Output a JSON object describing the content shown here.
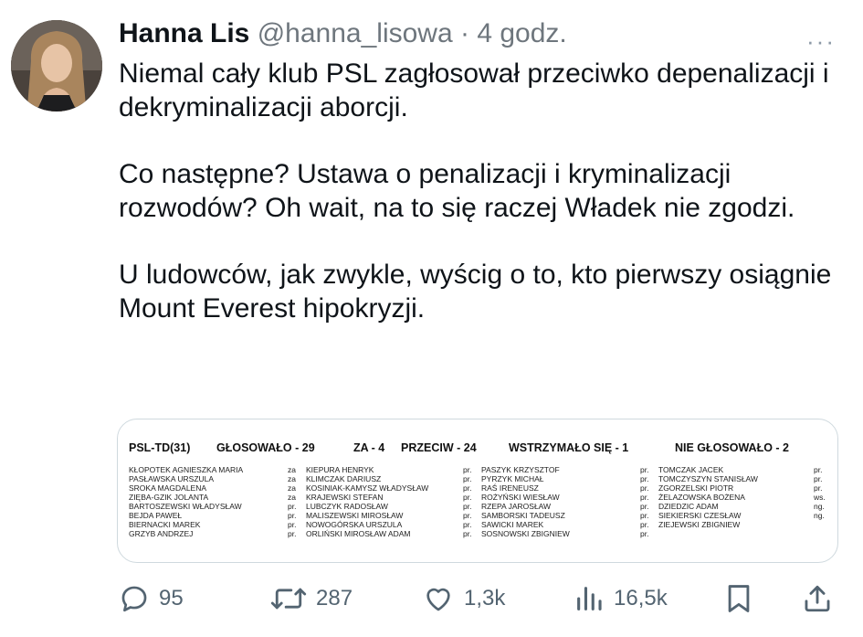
{
  "tweet": {
    "author_name": "Hanna Lis",
    "handle": "@hanna_lisowa",
    "separator": "·",
    "time": "4 godz.",
    "more": "···",
    "paragraphs": [
      "Niemal cały klub PSL zagłosował przeciwko depenalizacji i dekryminalizacji aborcji.",
      "Co następne? Ustawa o penalizacji i kryminalizacji rozwodów? Oh wait, na to się raczej Władek nie zgodzi.",
      "U ludowców, jak zwykle, wyścig o to, kto pierwszy osiągnie Mount Everest hipokryzji."
    ]
  },
  "vote_image": {
    "headers": {
      "club": "PSL-TD(31)",
      "voted": "GŁOSOWAŁO - 29",
      "for": "ZA - 4",
      "against": "PRZECIW - 24",
      "abstained": "WSTRZYMAŁO SIĘ - 1",
      "not_voted": "NIE GŁOSOWAŁO - 2"
    },
    "col1_names": [
      "KŁOPOTEK AGNIESZKA MARIA",
      "PASŁAWSKA URSZULA",
      "SROKA MAGDALENA",
      "ZIĘBA-GZIK JOLANTA",
      "BARTOSZEWSKI WŁADYSŁAW",
      "BEJDA PAWEŁ",
      "BIERNACKI MAREK",
      "GRZYB ANDRZEJ"
    ],
    "col1_votes": [
      "za",
      "za",
      "za",
      "za",
      "pr.",
      "pr.",
      "pr.",
      "pr."
    ],
    "col2_names": [
      "KIEPURA HENRYK",
      "KLIMCZAK DARIUSZ",
      "KOSINIAK-KAMYSZ WŁADYSŁAW",
      "KRAJEWSKI STEFAN",
      "LUBCZYK RADOSŁAW",
      "MALISZEWSKI MIROSŁAW",
      "NOWOGÓRSKA URSZULA",
      "ORLIŃSKI MIROSŁAW ADAM"
    ],
    "col2_votes": [
      "pr.",
      "pr.",
      "pr.",
      "pr.",
      "pr.",
      "pr.",
      "pr.",
      "pr."
    ],
    "col3_names": [
      "PASZYK KRZYSZTOF",
      "PYRZYK MICHAŁ",
      "RAŚ IRENEUSZ",
      "ROŻYŃSKI WIESŁAW",
      "RZEPA JAROSŁAW",
      "SAMBORSKI TADEUSZ",
      "SAWICKI MAREK",
      "SOSNOWSKI ZBIGNIEW"
    ],
    "col3_votes": [
      "pr.",
      "pr.",
      "pr.",
      "pr.",
      "pr.",
      "pr.",
      "pr.",
      "pr."
    ],
    "col4_names": [
      "TOMCZAK JACEK",
      "TOMCZYSZYN STANISŁAW",
      "ZGORZELSKI PIOTR",
      "ŻELAZOWSKA BOŻENA",
      "DZIEDZIC ADAM",
      "SIEKIERSKI CZESŁAW",
      "ZIEJEWSKI ZBIGNIEW",
      ""
    ],
    "col4_votes": [
      "pr.",
      "pr.",
      "pr.",
      "ws.",
      "ng.",
      "ng.",
      "",
      ""
    ]
  },
  "actions": {
    "replies": "95",
    "reposts": "287",
    "likes": "1,3k",
    "views": "16,5k"
  },
  "icons": {
    "reply": "reply-bubble-icon",
    "repost": "repost-arrows-icon",
    "like": "heart-icon",
    "views": "views-bar-chart-icon",
    "bookmark": "bookmark-icon",
    "share": "share-upload-icon"
  },
  "colors": {
    "text": "#0f1419",
    "secondary": "#536471",
    "border": "#cfd9de"
  }
}
